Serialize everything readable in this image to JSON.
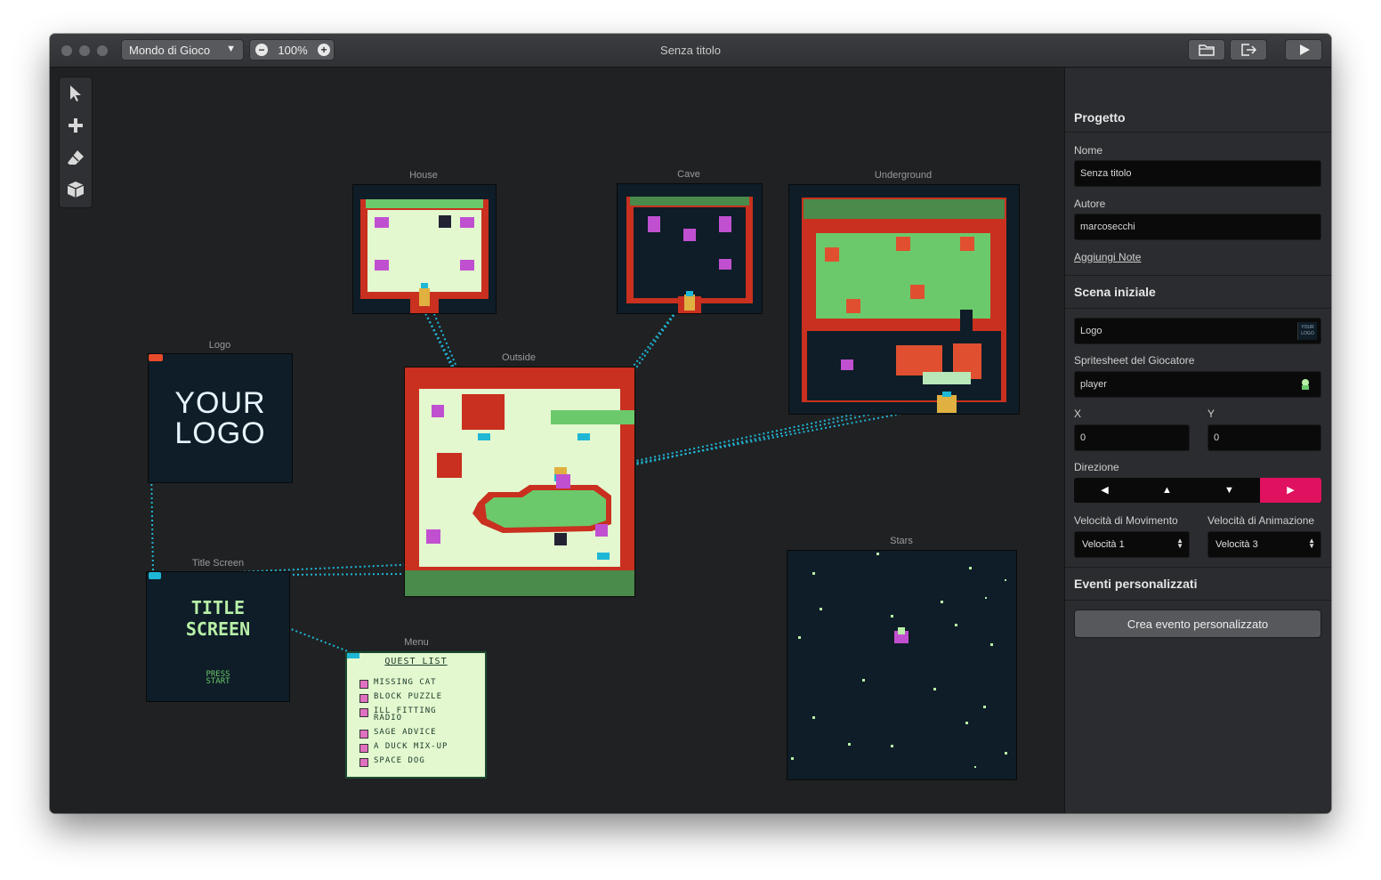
{
  "window": {
    "title": "Senza titolo",
    "world_select": {
      "label": "Mondo di Gioco"
    },
    "zoom": {
      "value": "100%"
    }
  },
  "scenes": {
    "house": {
      "label": "House"
    },
    "cave": {
      "label": "Cave"
    },
    "underground": {
      "label": "Underground"
    },
    "logo": {
      "label": "Logo",
      "text_line1": "YOUR",
      "text_line2": "LOGO"
    },
    "outside": {
      "label": "Outside"
    },
    "title_screen": {
      "label": "Title Screen",
      "text_line1": "TITLE",
      "text_line2": "SCREEN",
      "press_line1": "PRESS",
      "press_line2": "START"
    },
    "menu": {
      "label": "Menu",
      "heading": "QUEST LIST",
      "items": [
        "MISSING CAT",
        "BLOCK PUZZLE",
        "ILL FITTING",
        "RADIO",
        "SAGE ADVICE",
        "A DUCK MIX-UP",
        "SPACE DOG"
      ]
    },
    "stars": {
      "label": "Stars"
    }
  },
  "panel": {
    "project": {
      "heading": "Progetto",
      "name_label": "Nome",
      "name_value": "Senza titolo",
      "author_label": "Autore",
      "author_value": "marcosecchi",
      "notes_link": "Aggiungi Note"
    },
    "initial_scene": {
      "heading": "Scena iniziale",
      "scene_value": "Logo",
      "scene_thumb": "YOUR LOGO",
      "spritesheet_label": "Spritesheet del Giocatore",
      "spritesheet_value": "player",
      "x_label": "X",
      "x_value": "0",
      "y_label": "Y",
      "y_value": "0",
      "direction_label": "Direzione",
      "directions": [
        "left",
        "up",
        "down",
        "right"
      ],
      "direction_selected": "right",
      "move_speed_label": "Velocità di Movimento",
      "move_speed_value": "Velocità 1",
      "anim_speed_label": "Velocità di Animazione",
      "anim_speed_value": "Velocità 3"
    },
    "custom_events": {
      "heading": "Eventi personalizzati",
      "create_button": "Crea evento personalizzato"
    }
  },
  "colors": {
    "accent": "#e0115f",
    "connection": "#1fb7d6",
    "scene_bg": "#0e1d27",
    "gb_light": "#e3f8cf",
    "gb_green": "#6bc96b",
    "gb_red": "#c9301f"
  }
}
